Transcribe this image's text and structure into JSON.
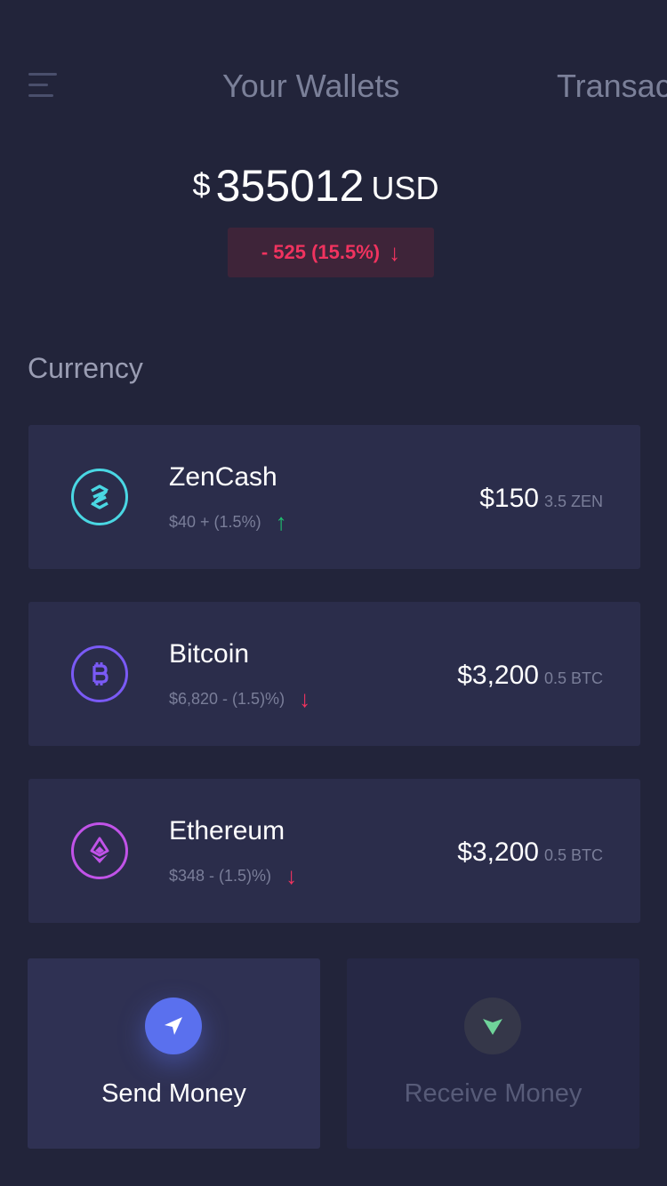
{
  "header": {
    "menu_icon": "hamburger-menu-icon",
    "tabs": [
      {
        "label": "Your Wallets"
      },
      {
        "label": "Transac"
      }
    ]
  },
  "balance": {
    "symbol": "$",
    "amount": "355012",
    "currency": "USD",
    "change": "- 525 (15.5%)",
    "change_direction": "down",
    "change_arrow": "↓"
  },
  "currency_section": {
    "title": "Currency",
    "items": [
      {
        "name": "ZenCash",
        "sub": "$40 + (1.5%)",
        "arrow": "↑",
        "direction": "up",
        "price": "$150",
        "qty": "3.5 ZEN",
        "icon": "zencash-coin-icon",
        "color": "#4ad7e3"
      },
      {
        "name": "Bitcoin",
        "sub": "$6,820  - (1.5)%)",
        "arrow": "↓",
        "direction": "down",
        "price": "$3,200",
        "qty": "0.5 BTC",
        "icon": "bitcoin-coin-icon",
        "color": "#7a5af5"
      },
      {
        "name": "Ethereum",
        "sub": "$348  - (1.5)%)",
        "arrow": "↓",
        "direction": "down",
        "price": "$3,200",
        "qty": "0.5 BTC",
        "icon": "ethereum-coin-icon",
        "color": "#c153e8"
      }
    ]
  },
  "actions": {
    "send": {
      "label": "Send Money",
      "icon": "send-paper-plane-icon",
      "color": "#5a70ee"
    },
    "receive": {
      "label": "Receive Money",
      "icon": "receive-chevron-icon",
      "color": "#6fd39a"
    }
  },
  "colors": {
    "background": "#22243a",
    "card": "#2b2d4b",
    "up": "#1fc06f",
    "down": "#f0335f"
  }
}
